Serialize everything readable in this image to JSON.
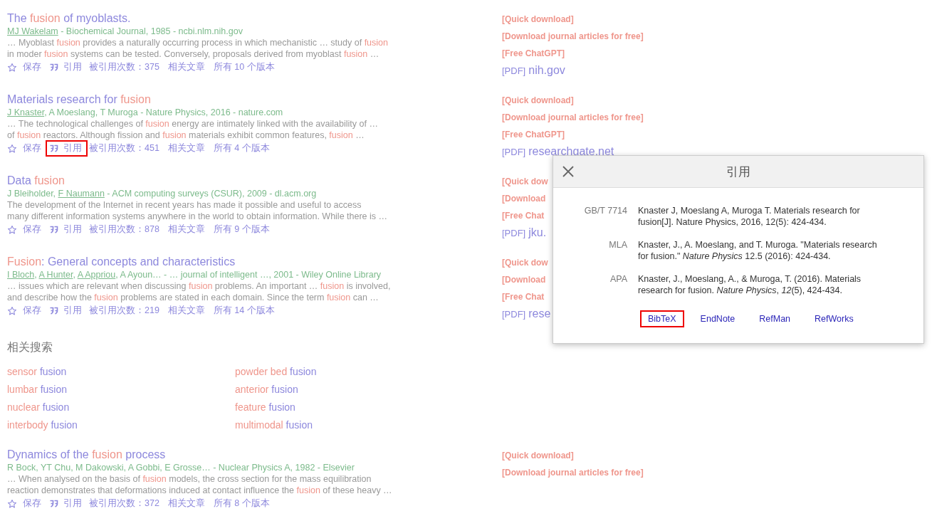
{
  "results": [
    {
      "title": [
        {
          "text": "The ",
          "hl": false
        },
        {
          "text": "fusion",
          "hl": true
        },
        {
          "text": " of myoblasts.",
          "hl": false
        }
      ],
      "authors": [
        {
          "text": "MJ Wakelam",
          "link": true
        },
        {
          "text": " - Biochemical Journal, 1985 - ncbi.nlm.nih.gov",
          "link": false
        }
      ],
      "snippet": [
        [
          {
            "text": "… Myoblast ",
            "hl": false
          },
          {
            "text": "fusion",
            "hl": true
          },
          {
            "text": " provides a naturally occurring process in which mechanistic … study of ",
            "hl": false
          },
          {
            "text": "fusion",
            "hl": true
          }
        ],
        [
          {
            "text": "in moder ",
            "hl": false
          },
          {
            "text": "fusion",
            "hl": true
          },
          {
            "text": " systems can be tested. Conversely, proposals derived from myoblast ",
            "hl": false
          },
          {
            "text": "fusion",
            "hl": true
          },
          {
            "text": " …",
            "hl": false
          }
        ]
      ],
      "actions": {
        "save": "保存",
        "cite": "引用",
        "cite_highlighted": false,
        "cited_by": "被引用次数：375",
        "related": "相关文章",
        "versions": "所有 10 个版本"
      },
      "side": [
        {
          "kind": "download",
          "text": "[Quick download]"
        },
        {
          "kind": "download",
          "text": "[Download journal articles for free]"
        },
        {
          "kind": "download",
          "text": "[Free ChatGPT]"
        },
        {
          "kind": "pdf",
          "tag": "[PDF]",
          "source": "nih.gov"
        }
      ]
    },
    {
      "title": [
        {
          "text": "Materials research for ",
          "hl": false
        },
        {
          "text": "fusion",
          "hl": true
        }
      ],
      "authors": [
        {
          "text": "J Knaster",
          "link": true
        },
        {
          "text": ", A Moeslang, T Muroga - Nature Physics, 2016 - nature.com",
          "link": false
        }
      ],
      "snippet": [
        [
          {
            "text": "… The technological challenges of ",
            "hl": false
          },
          {
            "text": "fusion",
            "hl": true
          },
          {
            "text": " energy are intimately linked with the availability of …",
            "hl": false
          }
        ],
        [
          {
            "text": "of ",
            "hl": false
          },
          {
            "text": "fusion",
            "hl": true
          },
          {
            "text": " reactors. Although fission and ",
            "hl": false
          },
          {
            "text": "fusion",
            "hl": true
          },
          {
            "text": " materials exhibit common features, ",
            "hl": false
          },
          {
            "text": "fusion",
            "hl": true
          },
          {
            "text": " …",
            "hl": false
          }
        ]
      ],
      "actions": {
        "save": "保存",
        "cite": "引用",
        "cite_highlighted": true,
        "cited_by": "被引用次数：451",
        "related": "相关文章",
        "versions": "所有 4 个版本"
      },
      "side": [
        {
          "kind": "download",
          "text": "[Quick download]"
        },
        {
          "kind": "download",
          "text": "[Download journal articles for free]"
        },
        {
          "kind": "download",
          "text": "[Free ChatGPT]"
        },
        {
          "kind": "pdf",
          "tag": "[PDF]",
          "source": "researchgate.net"
        }
      ]
    },
    {
      "title": [
        {
          "text": "Data ",
          "hl": false
        },
        {
          "text": "fusion",
          "hl": true
        }
      ],
      "authors": [
        {
          "text": "J Bleiholder, ",
          "link": false
        },
        {
          "text": "F Naumann",
          "link": true
        },
        {
          "text": " - ACM computing surveys (CSUR), 2009 - dl.acm.org",
          "link": false
        }
      ],
      "snippet": [
        [
          {
            "text": "The development of the Internet in recent years has made it possible and useful to access",
            "hl": false
          }
        ],
        [
          {
            "text": "many different information systems anywhere in the world to obtain information. While there is …",
            "hl": false
          }
        ]
      ],
      "actions": {
        "save": "保存",
        "cite": "引用",
        "cite_highlighted": false,
        "cited_by": "被引用次数：878",
        "related": "相关文章",
        "versions": "所有 9 个版本"
      },
      "side": [
        {
          "kind": "download",
          "text": "[Quick dow"
        },
        {
          "kind": "download",
          "text": "[Download"
        },
        {
          "kind": "download",
          "text": "[Free Chat"
        },
        {
          "kind": "pdf",
          "tag": "[PDF]",
          "source": "jku."
        }
      ]
    },
    {
      "title": [
        {
          "text": "Fusion",
          "hl": true
        },
        {
          "text": ": General concepts and characteristics",
          "hl": false
        }
      ],
      "authors": [
        {
          "text": "I Bloch",
          "link": true
        },
        {
          "text": ", ",
          "link": false
        },
        {
          "text": "A Hunter",
          "link": true
        },
        {
          "text": ", ",
          "link": false
        },
        {
          "text": "A Appriou",
          "link": true
        },
        {
          "text": ", A Ayoun… - … journal of intelligent …, 2001 - Wiley Online Library",
          "link": false
        }
      ],
      "snippet": [
        [
          {
            "text": "… issues which are relevant when discussing ",
            "hl": false
          },
          {
            "text": "fusion",
            "hl": true
          },
          {
            "text": " problems. An important … ",
            "hl": false
          },
          {
            "text": "fusion",
            "hl": true
          },
          {
            "text": " is involved,",
            "hl": false
          }
        ],
        [
          {
            "text": "and describe how the ",
            "hl": false
          },
          {
            "text": "fusion",
            "hl": true
          },
          {
            "text": " problems are stated in each domain. Since the term ",
            "hl": false
          },
          {
            "text": "fusion",
            "hl": true
          },
          {
            "text": " can …",
            "hl": false
          }
        ]
      ],
      "actions": {
        "save": "保存",
        "cite": "引用",
        "cite_highlighted": false,
        "cited_by": "被引用次数：219",
        "related": "相关文章",
        "versions": "所有 14 个版本"
      },
      "side": [
        {
          "kind": "download",
          "text": "[Quick dow"
        },
        {
          "kind": "download",
          "text": "[Download"
        },
        {
          "kind": "download",
          "text": "[Free Chat"
        },
        {
          "kind": "pdf",
          "tag": "[PDF]",
          "source": "rese"
        }
      ]
    }
  ],
  "related_searches": {
    "heading": "相关搜索",
    "items": [
      [
        {
          "text": "sensor ",
          "hl": true
        },
        {
          "text": "fusion",
          "hl": false
        }
      ],
      [
        {
          "text": "powder bed ",
          "hl": true
        },
        {
          "text": "fusion",
          "hl": false
        }
      ],
      [
        {
          "text": "lumbar ",
          "hl": true
        },
        {
          "text": "fusion",
          "hl": false
        }
      ],
      [
        {
          "text": "anterior ",
          "hl": true
        },
        {
          "text": "fusion",
          "hl": false
        }
      ],
      [
        {
          "text": "nuclear ",
          "hl": true
        },
        {
          "text": "fusion",
          "hl": false
        }
      ],
      [
        {
          "text": "feature ",
          "hl": true
        },
        {
          "text": "fusion",
          "hl": false
        }
      ],
      [
        {
          "text": "interbody ",
          "hl": true
        },
        {
          "text": "fusion",
          "hl": false
        }
      ],
      [
        {
          "text": "multimodal ",
          "hl": true
        },
        {
          "text": "fusion",
          "hl": false
        }
      ]
    ]
  },
  "last_result": {
    "title": [
      {
        "text": "Dynamics of the ",
        "hl": false
      },
      {
        "text": "fusion",
        "hl": true
      },
      {
        "text": " process",
        "hl": false
      }
    ],
    "authors": [
      {
        "text": "R Bock, YT Chu, M Dakowski, A Gobbi, E Grosse… - Nuclear Physics A, 1982 - Elsevier",
        "link": false
      }
    ],
    "snippet": [
      [
        {
          "text": "… When analysed on the basis of ",
          "hl": false
        },
        {
          "text": "fusion",
          "hl": true
        },
        {
          "text": " models, the cross section for the mass equilibration",
          "hl": false
        }
      ],
      [
        {
          "text": "reaction demonstrates that deformations induced at contact influence the ",
          "hl": false
        },
        {
          "text": "fusion",
          "hl": true
        },
        {
          "text": " of these heavy …",
          "hl": false
        }
      ]
    ],
    "actions": {
      "save": "保存",
      "cite": "引用",
      "cite_highlighted": false,
      "cited_by": "被引用次数：372",
      "related": "相关文章",
      "versions": "所有 8 个版本"
    },
    "side": [
      {
        "kind": "download",
        "text": "[Quick download]"
      },
      {
        "kind": "download",
        "text": "[Download journal articles for free]"
      }
    ]
  },
  "cite_dialog": {
    "title": "引用",
    "citations": [
      {
        "style": "GB/T 7714",
        "text": "Knaster J, Moeslang A, Muroga T. Materials research for fusion[J]. Nature Physics, 2016, 12(5): 424-434."
      },
      {
        "style": "MLA",
        "text": "Knaster, J., A. Moeslang, and T. Muroga. \"Materials research for fusion.\" *Nature Physics* 12.5 (2016): 424-434."
      },
      {
        "style": "APA",
        "text": "Knaster, J., Moeslang, A., & Muroga, T. (2016). Materials research for fusion. *Nature Physics*, *12*(5), 424-434."
      }
    ],
    "exports": [
      {
        "label": "BibTeX",
        "highlighted": true
      },
      {
        "label": "EndNote",
        "highlighted": false
      },
      {
        "label": "RefMan",
        "highlighted": false
      },
      {
        "label": "RefWorks",
        "highlighted": false
      }
    ]
  }
}
